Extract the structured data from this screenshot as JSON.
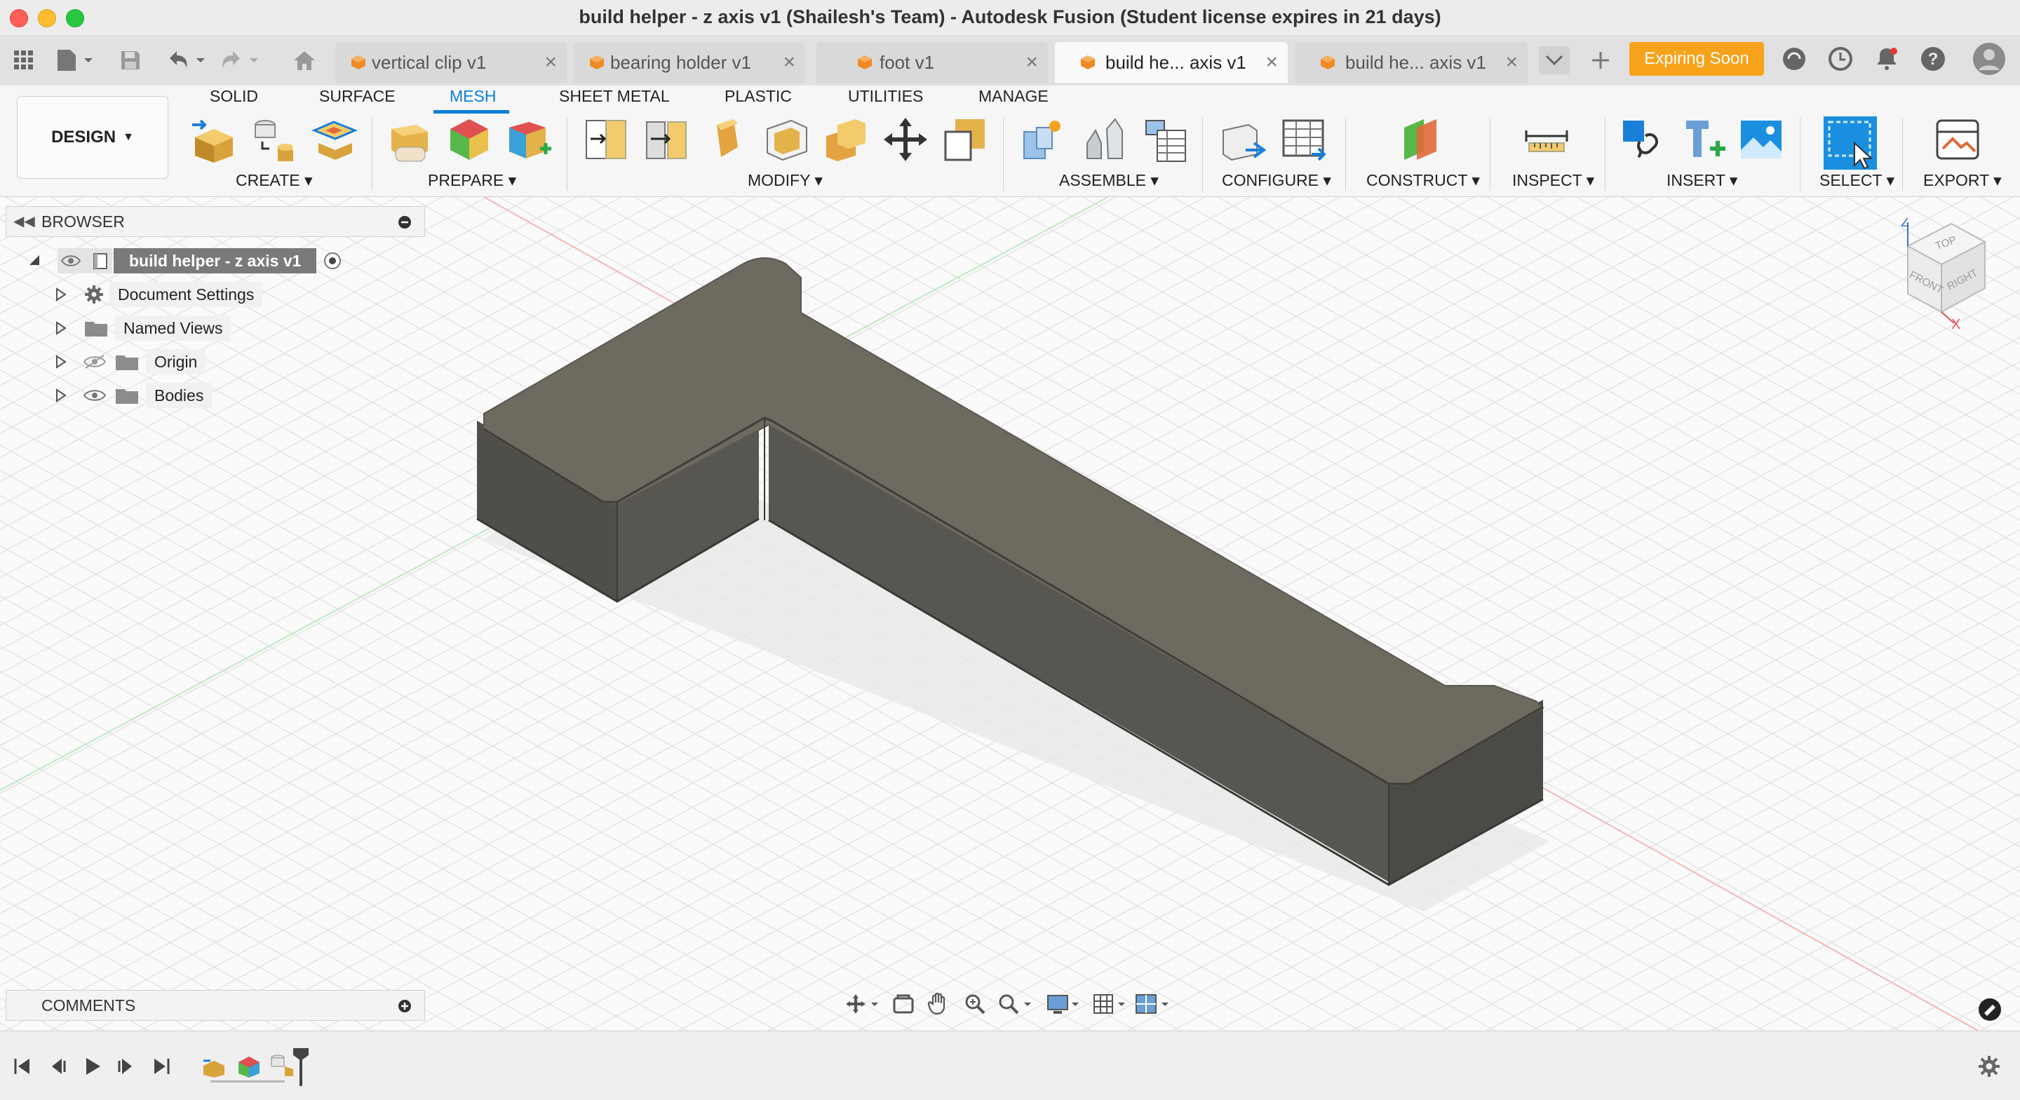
{
  "window": {
    "title": "build helper - z axis v1 (Shailesh's Team) - Autodesk Fusion (Student license expires in 21 days)"
  },
  "tabs": [
    {
      "label": "vertical clip v1",
      "active": false
    },
    {
      "label": "bearing holder v1",
      "active": false
    },
    {
      "label": "foot v1",
      "active": false
    },
    {
      "label": "build he... axis v1",
      "active": true
    },
    {
      "label": "build he... axis v1",
      "active": false
    }
  ],
  "header": {
    "expiring_label": "Expiring Soon"
  },
  "ribbon": {
    "workspace_label": "DESIGN",
    "tabs": [
      "SOLID",
      "SURFACE",
      "MESH",
      "SHEET METAL",
      "PLASTIC",
      "UTILITIES",
      "MANAGE"
    ],
    "active_tab": "MESH",
    "groups": [
      "CREATE",
      "PREPARE",
      "MODIFY",
      "ASSEMBLE",
      "CONFIGURE",
      "CONSTRUCT",
      "INSPECT",
      "INSERT",
      "SELECT",
      "EXPORT"
    ]
  },
  "browser": {
    "title": "BROWSER",
    "root": "build helper - z axis v1",
    "items": [
      "Document Settings",
      "Named Views",
      "Origin",
      "Bodies"
    ]
  },
  "comments": {
    "title": "COMMENTS"
  },
  "viewcube": {
    "top": "TOP",
    "front": "FRONT",
    "right": "RIGHT",
    "axis_z": "Z",
    "axis_x": "X"
  },
  "colors": {
    "accent": "#0a7fd6",
    "expiring": "#f7a21b",
    "body_top": "#6e6a5f",
    "body_side": "#5b5a55"
  }
}
